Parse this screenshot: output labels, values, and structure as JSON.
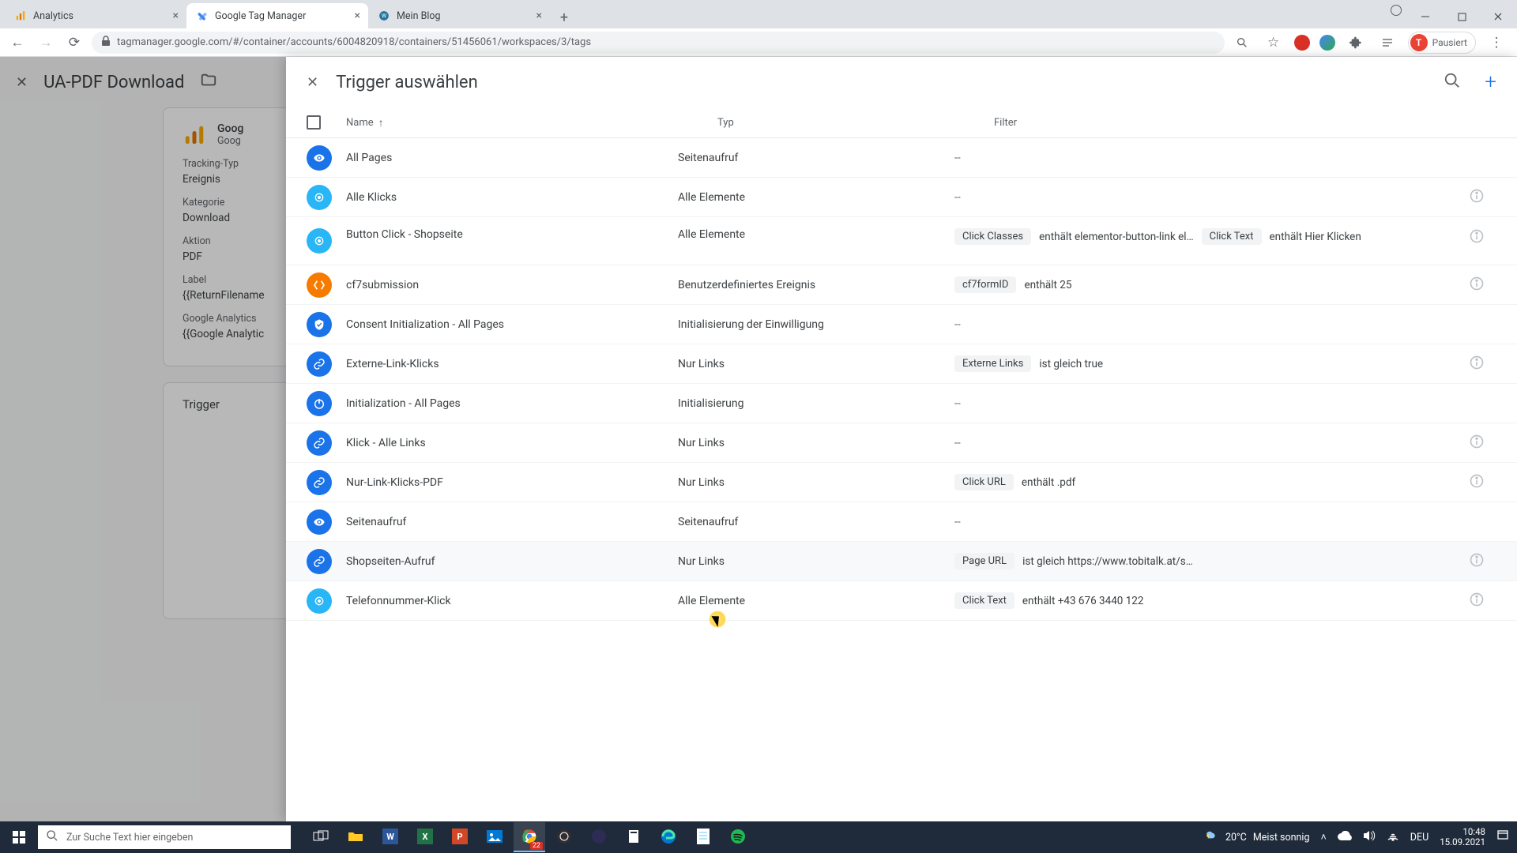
{
  "browser": {
    "tabs": [
      {
        "title": "Analytics",
        "favicon": "analytics"
      },
      {
        "title": "Google Tag Manager",
        "favicon": "gtm",
        "active": true
      },
      {
        "title": "Mein Blog",
        "favicon": "wp"
      }
    ],
    "url": "tagmanager.google.com/#/container/accounts/6004820918/containers/51456061/workspaces/3/tags",
    "profile_state": "Pausiert",
    "profile_initial": "T"
  },
  "tag_editor": {
    "title": "UA-PDF Download",
    "config_title": "Goog",
    "config_sub": "Goog",
    "fields": {
      "tracking_type_label": "Tracking-Typ",
      "tracking_type_value": "Ereignis",
      "category_label": "Kategorie",
      "category_value": "Download",
      "action_label": "Aktion",
      "action_value": "PDF",
      "label_label": "Label",
      "label_value": "{{ReturnFilename",
      "ga_label": "Google Analytics",
      "ga_value": "{{Google Analytic"
    },
    "trigger_card_title": "Trigger"
  },
  "panel": {
    "title": "Trigger auswählen",
    "col_name": "Name",
    "col_type": "Typ",
    "col_filter": "Filter"
  },
  "triggers": [
    {
      "icon": "eye",
      "name": "All Pages",
      "type": "Seitenaufruf",
      "filter": [
        {
          "dash": true
        }
      ]
    },
    {
      "icon": "click",
      "name": "Alle Klicks",
      "type": "Alle Elemente",
      "filter": [
        {
          "dash": true
        }
      ],
      "info": true
    },
    {
      "icon": "click",
      "name": "Button Click - Shopseite",
      "type": "Alle Elemente",
      "filter": [
        {
          "chip": "Click Classes",
          "text": "enthält elementor-button-link el…"
        },
        {
          "chip": "Click Text",
          "text": "enthält Hier Klicken"
        }
      ],
      "info": true,
      "multiline": true
    },
    {
      "icon": "custom",
      "name": "cf7submission",
      "type": "Benutzerdefiniertes Ereignis",
      "filter": [
        {
          "chip": "cf7formID",
          "text": "enthält 25"
        }
      ],
      "info": true
    },
    {
      "icon": "consent",
      "name": "Consent Initialization - All Pages",
      "type": "Initialisierung der Einwilligung",
      "filter": [
        {
          "dash": true
        }
      ]
    },
    {
      "icon": "link",
      "name": "Externe-Link-Klicks",
      "type": "Nur Links",
      "filter": [
        {
          "chip": "Externe Links",
          "text": "ist gleich true"
        }
      ],
      "info": true
    },
    {
      "icon": "init",
      "name": "Initialization - All Pages",
      "type": "Initialisierung",
      "filter": [
        {
          "dash": true
        }
      ]
    },
    {
      "icon": "link",
      "name": "Klick - Alle Links",
      "type": "Nur Links",
      "filter": [
        {
          "dash": true
        }
      ],
      "info": true
    },
    {
      "icon": "link",
      "name": "Nur-Link-Klicks-PDF",
      "type": "Nur Links",
      "filter": [
        {
          "chip": "Click URL",
          "text": "enthält .pdf"
        }
      ],
      "info": true
    },
    {
      "icon": "eye",
      "name": "Seitenaufruf",
      "type": "Seitenaufruf",
      "filter": [
        {
          "dash": true
        }
      ]
    },
    {
      "icon": "link",
      "name": "Shopseiten-Aufruf",
      "type": "Nur Links",
      "filter": [
        {
          "chip": "Page URL",
          "text": "ist gleich https://www.tobitalk.at/s…"
        }
      ],
      "info": true,
      "hovered": true
    },
    {
      "icon": "click",
      "name": "Telefonnummer-Klick",
      "type": "Alle Elemente",
      "filter": [
        {
          "chip": "Click Text",
          "text": "enthält +43 676 3440 122"
        }
      ],
      "info": true
    }
  ],
  "taskbar": {
    "search_placeholder": "Zur Suche Text hier eingeben",
    "weather_temp": "20°C",
    "weather_text": "Meist sonnig",
    "lang": "DEU",
    "time": "10:48",
    "date": "15.09.2021",
    "chrome_badge": "22"
  }
}
